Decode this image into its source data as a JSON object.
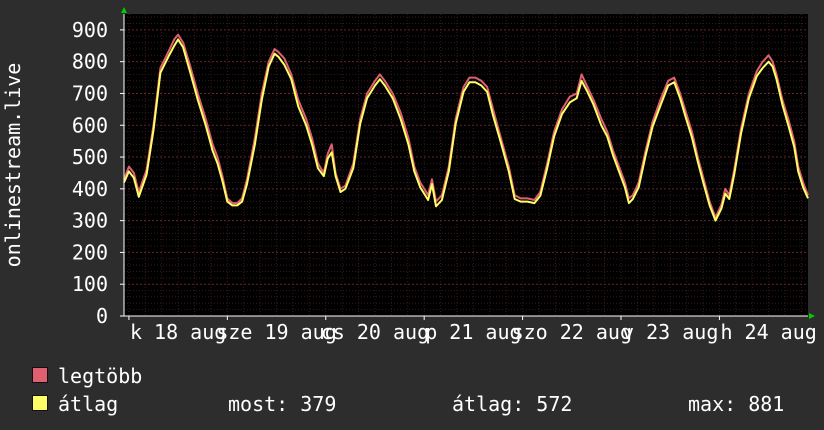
{
  "colors": {
    "background": "#2d2d2d",
    "plot_background": "#000000",
    "grid": "#5a1f1f",
    "axis_text": "#ffffff",
    "max_series": "#e06070",
    "avg_series": "#ffff66",
    "axis_arrow": "#00cc00"
  },
  "chart_data": {
    "type": "line",
    "title": "",
    "ylabel": "onlinestream.live",
    "xlabel": "",
    "ylim": [
      0,
      950
    ],
    "yticks": [
      0,
      100,
      200,
      300,
      400,
      500,
      600,
      700,
      800,
      900
    ],
    "grid": true,
    "x_tick_labels": [
      {
        "text": "k 18 aug",
        "at": 0
      },
      {
        "text": "sze 19 aug",
        "at": 1
      },
      {
        "text": "cs 20 aug",
        "at": 2
      },
      {
        "text": "p 21 aug",
        "at": 3
      },
      {
        "text": "szo 22 aug",
        "at": 4
      },
      {
        "text": "v 23 aug",
        "at": 5
      },
      {
        "text": "h 24 aug",
        "at": 6
      }
    ],
    "x_start": -0.05,
    "x_end": 6.9,
    "series": [
      {
        "name": "legtöbb",
        "color": "#e06070",
        "points": [
          [
            -0.05,
            430
          ],
          [
            0.0,
            470
          ],
          [
            0.05,
            450
          ],
          [
            0.1,
            390
          ],
          [
            0.18,
            460
          ],
          [
            0.25,
            600
          ],
          [
            0.32,
            780
          ],
          [
            0.4,
            830
          ],
          [
            0.46,
            870
          ],
          [
            0.5,
            885
          ],
          [
            0.55,
            860
          ],
          [
            0.62,
            790
          ],
          [
            0.7,
            700
          ],
          [
            0.78,
            620
          ],
          [
            0.85,
            540
          ],
          [
            0.9,
            500
          ],
          [
            0.95,
            440
          ],
          [
            1.0,
            370
          ],
          [
            1.05,
            355
          ],
          [
            1.1,
            355
          ],
          [
            1.15,
            370
          ],
          [
            1.2,
            430
          ],
          [
            1.28,
            560
          ],
          [
            1.35,
            700
          ],
          [
            1.42,
            800
          ],
          [
            1.48,
            840
          ],
          [
            1.52,
            830
          ],
          [
            1.58,
            810
          ],
          [
            1.65,
            760
          ],
          [
            1.72,
            680
          ],
          [
            1.8,
            620
          ],
          [
            1.86,
            560
          ],
          [
            1.92,
            480
          ],
          [
            1.98,
            450
          ],
          [
            2.02,
            510
          ],
          [
            2.06,
            540
          ],
          [
            2.1,
            450
          ],
          [
            2.15,
            400
          ],
          [
            2.2,
            410
          ],
          [
            2.28,
            480
          ],
          [
            2.35,
            620
          ],
          [
            2.42,
            700
          ],
          [
            2.5,
            740
          ],
          [
            2.55,
            760
          ],
          [
            2.6,
            740
          ],
          [
            2.68,
            700
          ],
          [
            2.76,
            640
          ],
          [
            2.84,
            560
          ],
          [
            2.9,
            470
          ],
          [
            2.96,
            420
          ],
          [
            3.0,
            400
          ],
          [
            3.04,
            380
          ],
          [
            3.08,
            430
          ],
          [
            3.12,
            360
          ],
          [
            3.18,
            380
          ],
          [
            3.25,
            470
          ],
          [
            3.32,
            620
          ],
          [
            3.4,
            720
          ],
          [
            3.46,
            750
          ],
          [
            3.52,
            750
          ],
          [
            3.58,
            740
          ],
          [
            3.64,
            720
          ],
          [
            3.7,
            650
          ],
          [
            3.78,
            560
          ],
          [
            3.86,
            470
          ],
          [
            3.92,
            380
          ],
          [
            3.98,
            370
          ],
          [
            4.05,
            370
          ],
          [
            4.12,
            365
          ],
          [
            4.18,
            390
          ],
          [
            4.25,
            480
          ],
          [
            4.32,
            580
          ],
          [
            4.4,
            650
          ],
          [
            4.48,
            690
          ],
          [
            4.55,
            700
          ],
          [
            4.6,
            760
          ],
          [
            4.66,
            720
          ],
          [
            4.72,
            680
          ],
          [
            4.8,
            620
          ],
          [
            4.86,
            580
          ],
          [
            4.92,
            520
          ],
          [
            4.98,
            470
          ],
          [
            5.04,
            420
          ],
          [
            5.08,
            370
          ],
          [
            5.12,
            380
          ],
          [
            5.18,
            420
          ],
          [
            5.25,
            520
          ],
          [
            5.32,
            610
          ],
          [
            5.4,
            680
          ],
          [
            5.48,
            740
          ],
          [
            5.54,
            750
          ],
          [
            5.6,
            700
          ],
          [
            5.66,
            640
          ],
          [
            5.72,
            580
          ],
          [
            5.78,
            500
          ],
          [
            5.84,
            430
          ],
          [
            5.9,
            360
          ],
          [
            5.96,
            310
          ],
          [
            6.02,
            350
          ],
          [
            6.06,
            400
          ],
          [
            6.1,
            380
          ],
          [
            6.15,
            460
          ],
          [
            6.22,
            590
          ],
          [
            6.3,
            700
          ],
          [
            6.38,
            770
          ],
          [
            6.44,
            800
          ],
          [
            6.5,
            820
          ],
          [
            6.54,
            800
          ],
          [
            6.58,
            760
          ],
          [
            6.64,
            680
          ],
          [
            6.7,
            620
          ],
          [
            6.76,
            550
          ],
          [
            6.8,
            470
          ],
          [
            6.85,
            420
          ],
          [
            6.9,
            380
          ]
        ]
      },
      {
        "name": "átlag",
        "color": "#ffff66",
        "points": [
          [
            -0.05,
            420
          ],
          [
            0.0,
            455
          ],
          [
            0.05,
            435
          ],
          [
            0.1,
            375
          ],
          [
            0.18,
            445
          ],
          [
            0.25,
            585
          ],
          [
            0.32,
            765
          ],
          [
            0.4,
            815
          ],
          [
            0.46,
            850
          ],
          [
            0.5,
            870
          ],
          [
            0.55,
            845
          ],
          [
            0.62,
            770
          ],
          [
            0.7,
            680
          ],
          [
            0.78,
            600
          ],
          [
            0.85,
            520
          ],
          [
            0.9,
            480
          ],
          [
            0.95,
            425
          ],
          [
            1.0,
            360
          ],
          [
            1.05,
            348
          ],
          [
            1.1,
            348
          ],
          [
            1.15,
            360
          ],
          [
            1.2,
            415
          ],
          [
            1.28,
            540
          ],
          [
            1.35,
            680
          ],
          [
            1.42,
            785
          ],
          [
            1.48,
            825
          ],
          [
            1.52,
            815
          ],
          [
            1.58,
            790
          ],
          [
            1.65,
            745
          ],
          [
            1.72,
            660
          ],
          [
            1.8,
            600
          ],
          [
            1.86,
            540
          ],
          [
            1.92,
            465
          ],
          [
            1.98,
            440
          ],
          [
            2.02,
            495
          ],
          [
            2.06,
            515
          ],
          [
            2.1,
            440
          ],
          [
            2.15,
            390
          ],
          [
            2.2,
            400
          ],
          [
            2.28,
            465
          ],
          [
            2.35,
            605
          ],
          [
            2.42,
            685
          ],
          [
            2.5,
            725
          ],
          [
            2.55,
            745
          ],
          [
            2.6,
            725
          ],
          [
            2.68,
            685
          ],
          [
            2.76,
            620
          ],
          [
            2.84,
            540
          ],
          [
            2.9,
            455
          ],
          [
            2.96,
            405
          ],
          [
            3.0,
            385
          ],
          [
            3.04,
            365
          ],
          [
            3.08,
            415
          ],
          [
            3.12,
            345
          ],
          [
            3.18,
            365
          ],
          [
            3.25,
            455
          ],
          [
            3.32,
            605
          ],
          [
            3.4,
            705
          ],
          [
            3.46,
            735
          ],
          [
            3.52,
            735
          ],
          [
            3.58,
            725
          ],
          [
            3.64,
            705
          ],
          [
            3.7,
            630
          ],
          [
            3.78,
            545
          ],
          [
            3.86,
            455
          ],
          [
            3.92,
            368
          ],
          [
            3.98,
            360
          ],
          [
            4.05,
            360
          ],
          [
            4.12,
            355
          ],
          [
            4.18,
            378
          ],
          [
            4.25,
            465
          ],
          [
            4.32,
            565
          ],
          [
            4.4,
            635
          ],
          [
            4.48,
            672
          ],
          [
            4.55,
            685
          ],
          [
            4.6,
            740
          ],
          [
            4.66,
            705
          ],
          [
            4.72,
            665
          ],
          [
            4.8,
            600
          ],
          [
            4.86,
            565
          ],
          [
            4.92,
            505
          ],
          [
            4.98,
            455
          ],
          [
            5.04,
            405
          ],
          [
            5.08,
            355
          ],
          [
            5.12,
            368
          ],
          [
            5.18,
            405
          ],
          [
            5.25,
            505
          ],
          [
            5.32,
            595
          ],
          [
            5.4,
            662
          ],
          [
            5.48,
            725
          ],
          [
            5.54,
            735
          ],
          [
            5.6,
            685
          ],
          [
            5.66,
            622
          ],
          [
            5.72,
            562
          ],
          [
            5.78,
            485
          ],
          [
            5.84,
            415
          ],
          [
            5.9,
            348
          ],
          [
            5.96,
            300
          ],
          [
            6.02,
            338
          ],
          [
            6.06,
            385
          ],
          [
            6.1,
            368
          ],
          [
            6.15,
            445
          ],
          [
            6.22,
            575
          ],
          [
            6.3,
            685
          ],
          [
            6.38,
            755
          ],
          [
            6.44,
            780
          ],
          [
            6.5,
            800
          ],
          [
            6.54,
            785
          ],
          [
            6.58,
            745
          ],
          [
            6.64,
            665
          ],
          [
            6.7,
            600
          ],
          [
            6.76,
            532
          ],
          [
            6.8,
            455
          ],
          [
            6.85,
            405
          ],
          [
            6.9,
            370
          ]
        ]
      }
    ]
  },
  "legend": {
    "items": [
      {
        "label": "legtöbb",
        "color": "#e06070"
      },
      {
        "label": "átlag",
        "color": "#ffff66"
      }
    ],
    "stats": {
      "most": "most: 379",
      "atlag": "átlag: 572",
      "max": "max: 881"
    }
  }
}
